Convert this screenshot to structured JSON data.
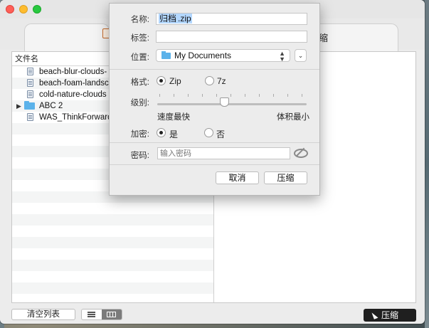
{
  "toolbar": {
    "tab_right_label": "缩"
  },
  "file_list": {
    "column_header": "文件名",
    "rows": [
      {
        "name": "beach-blur-clouds-",
        "type": "file"
      },
      {
        "name": "beach-foam-landsc",
        "type": "file"
      },
      {
        "name": "cold-nature-clouds",
        "type": "file"
      },
      {
        "name": "ABC 2",
        "type": "folder"
      },
      {
        "name": "WAS_ThinkForward",
        "type": "file"
      }
    ]
  },
  "bottom_bar": {
    "clear_label": "清空列表",
    "compress_label": "压缩"
  },
  "dialog": {
    "name_label": "名称:",
    "name_value_selected": "归档",
    "name_value_ext": ".zip",
    "tags_label": "标签:",
    "tags_value": "",
    "location_label": "位置:",
    "location_value": "My Documents",
    "format_label": "格式:",
    "format_options": [
      "Zip",
      "7z"
    ],
    "format_selected": "Zip",
    "level_label": "级别:",
    "level_min_label": "速度最快",
    "level_max_label": "体积最小",
    "level_value_fraction": 0.45,
    "encrypt_label": "加密:",
    "encrypt_options": [
      "是",
      "否"
    ],
    "encrypt_selected": "是",
    "password_label": "密码:",
    "password_placeholder": "输入密码",
    "cancel_label": "取消",
    "compress_label": "压缩"
  }
}
